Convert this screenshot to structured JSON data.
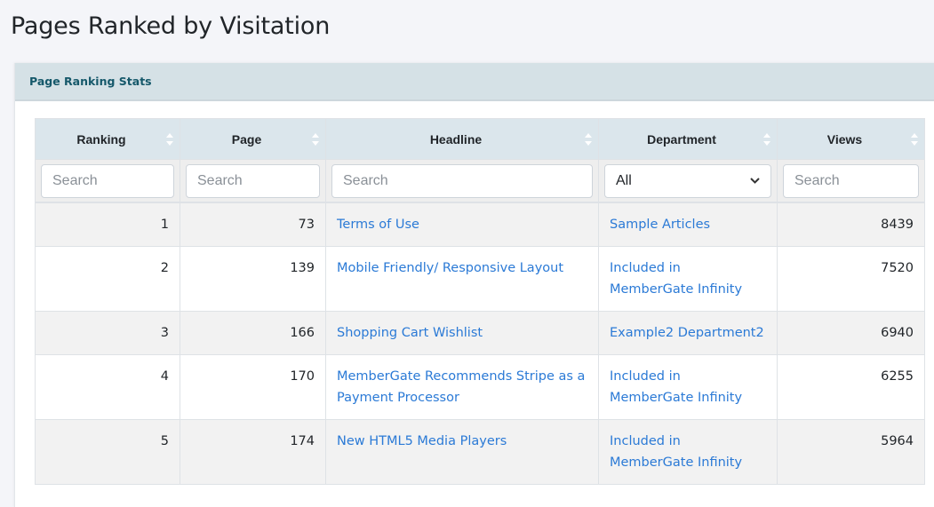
{
  "page": {
    "title": "Pages Ranked by Visitation"
  },
  "card": {
    "title": "Page Ranking Stats"
  },
  "table": {
    "columns": [
      {
        "label": "Ranking",
        "filter_type": "input",
        "placeholder": "Search"
      },
      {
        "label": "Page",
        "filter_type": "input",
        "placeholder": "Search"
      },
      {
        "label": "Headline",
        "filter_type": "input",
        "placeholder": "Search"
      },
      {
        "label": "Department",
        "filter_type": "select",
        "selected": "All"
      },
      {
        "label": "Views",
        "filter_type": "input",
        "placeholder": "Search"
      }
    ],
    "rows": [
      {
        "ranking": "1",
        "page": "73",
        "headline": "Terms of Use",
        "department": "Sample Articles",
        "views": "8439"
      },
      {
        "ranking": "2",
        "page": "139",
        "headline": "Mobile Friendly/ Responsive Layout",
        "department": "Included in MemberGate Infinity",
        "views": "7520"
      },
      {
        "ranking": "3",
        "page": "166",
        "headline": "Shopping Cart Wishlist",
        "department": "Example2 Department2",
        "views": "6940"
      },
      {
        "ranking": "4",
        "page": "170",
        "headline": "MemberGate Recommends Stripe as a Payment Processor",
        "department": "Included in MemberGate Infinity",
        "views": "6255"
      },
      {
        "ranking": "5",
        "page": "174",
        "headline": "New HTML5 Media Players",
        "department": "Included in MemberGate Infinity",
        "views": "5964"
      }
    ]
  },
  "icons": {
    "sort": "sort-both-icon",
    "select": "chevron-down-icon"
  },
  "colors": {
    "link": "#2b7ad6",
    "card_header_bg": "#d5e1e6",
    "card_header_text": "#15586a",
    "table_header_bg": "#dbe6ec"
  }
}
